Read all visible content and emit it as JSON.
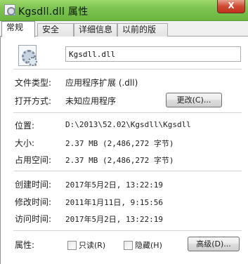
{
  "window": {
    "title": "Kgsdll.dll 属性",
    "close_glyph": "X"
  },
  "tabs": [
    {
      "label": "常规",
      "active": true
    },
    {
      "label": "安全",
      "active": false
    },
    {
      "label": "详细信息",
      "active": false
    },
    {
      "label": "以前的版本",
      "active": false
    }
  ],
  "general": {
    "file_icon": "dll-gear-file-icon",
    "file_name": "Kgsdll.dll",
    "file_type": {
      "label": "文件类型:",
      "value": "应用程序扩展 (.dll)"
    },
    "opens_with": {
      "label": "打开方式:",
      "value": "未知应用程序",
      "change_button": "更改(C)..."
    },
    "location": {
      "label": "位置:",
      "value": "D:\\2013\\52.02\\Kgsdll\\Kgsdll"
    },
    "size": {
      "label": "大小:",
      "value": "2.37 MB (2,486,272 字节)"
    },
    "size_on_disk": {
      "label": "占用空间:",
      "value": "2.37 MB (2,486,272 字节)"
    },
    "created": {
      "label": "创建时间:",
      "value": "2017年5月2日, 13:22:19"
    },
    "modified": {
      "label": "修改时间:",
      "value": "2011年1月11日, 9:15:56"
    },
    "accessed": {
      "label": "访问时间:",
      "value": "2017年5月2日, 13:22:19"
    },
    "attributes": {
      "label": "属性:",
      "readonly": {
        "label": "只读(R)",
        "checked": false
      },
      "hidden": {
        "label": "隐藏(H)",
        "checked": false
      },
      "advanced_button": "高级(D)..."
    }
  }
}
